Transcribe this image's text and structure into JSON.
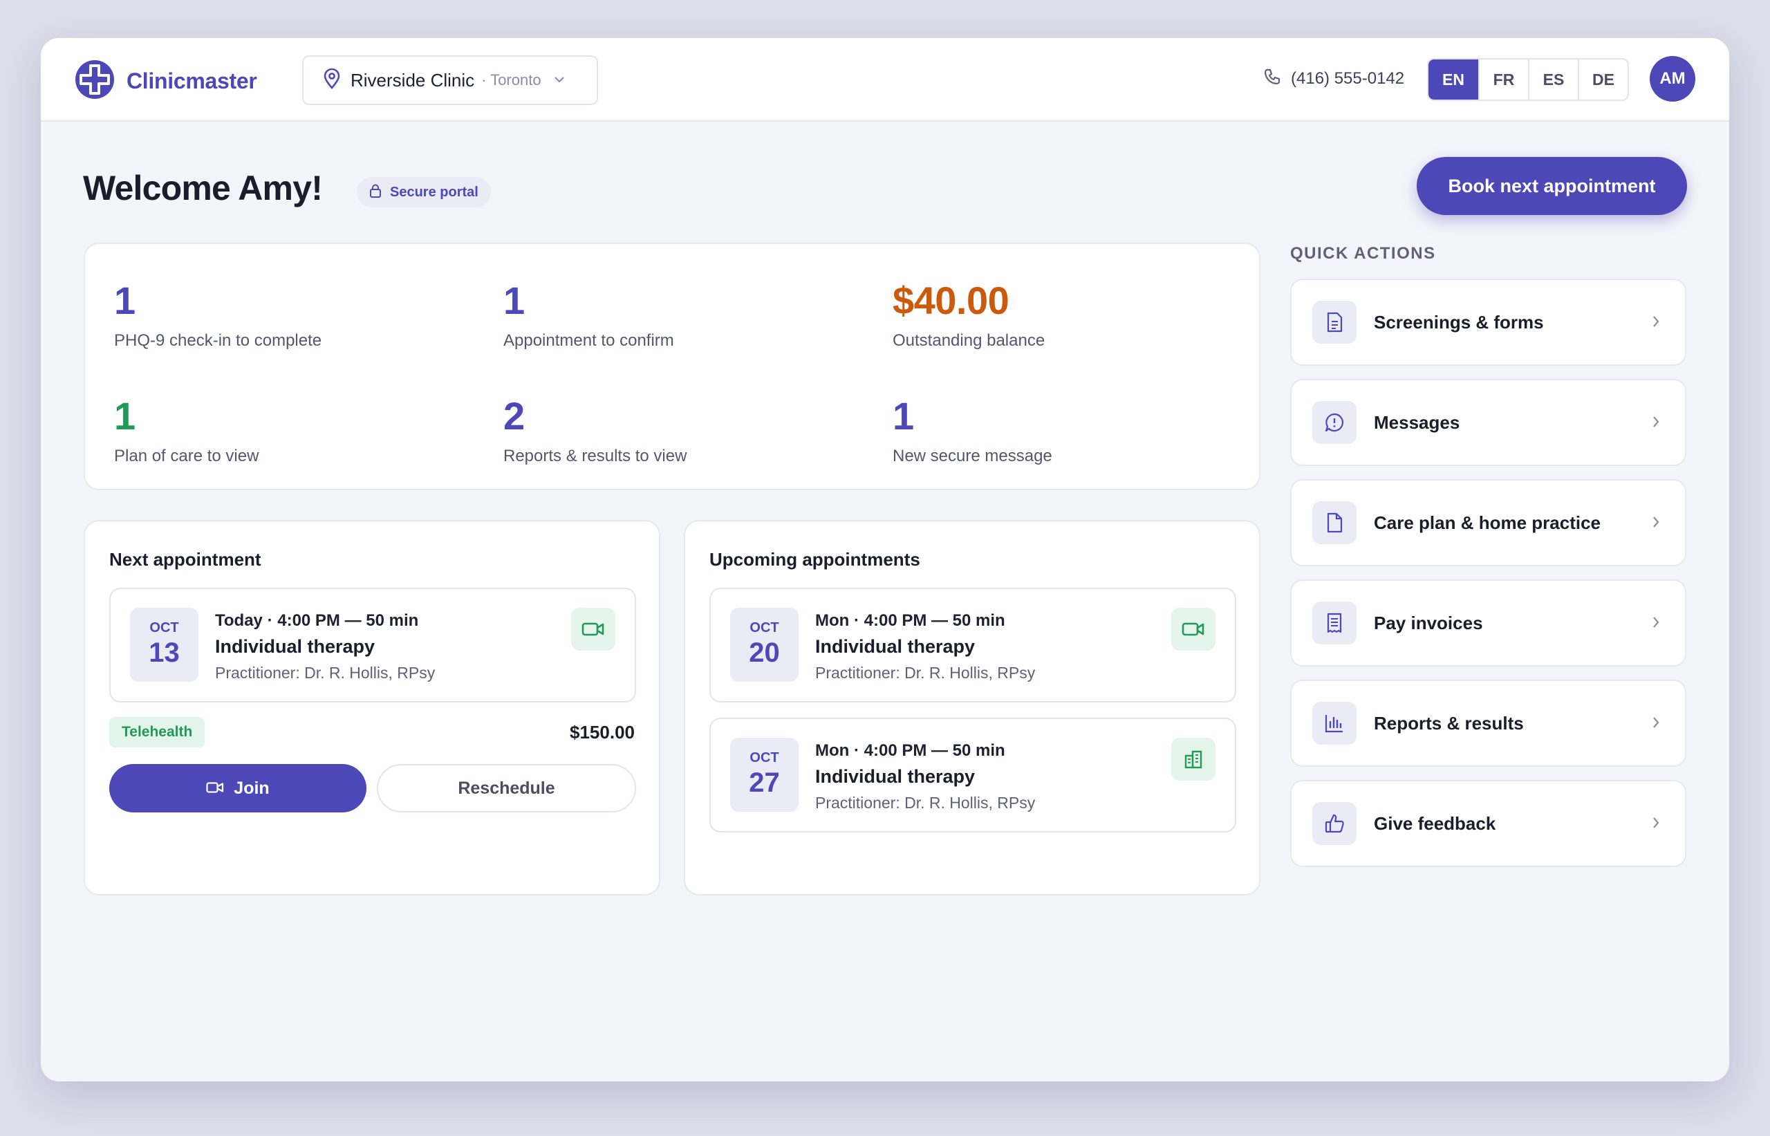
{
  "header": {
    "brand_name": "Clinicmaster",
    "clinic_name": "Riverside Clinic",
    "clinic_city": "· Toronto",
    "phone": "(416) 555-0142",
    "languages": [
      "EN",
      "FR",
      "ES",
      "DE"
    ],
    "active_language": "EN",
    "avatar_initials": "AM"
  },
  "page": {
    "welcome": "Welcome Amy!",
    "secure_badge": "Secure portal",
    "book_button": "Book next appointment"
  },
  "summary": [
    {
      "value": "1",
      "label": "PHQ-9 check-in to complete",
      "color": "#4d48b8"
    },
    {
      "value": "1",
      "label": "Appointment to confirm",
      "color": "#4d48b8"
    },
    {
      "value": "$40.00",
      "label": "Outstanding balance",
      "color": "#cc5a0c"
    },
    {
      "value": "1",
      "label": "Plan of care to view",
      "color": "#1f9a57"
    },
    {
      "value": "2",
      "label": "Reports & results to view",
      "color": "#4d48b8"
    },
    {
      "value": "1",
      "label": "New secure message",
      "color": "#4d48b8"
    }
  ],
  "next_appointment": {
    "title": "Next appointment",
    "month": "OCT",
    "day": "13",
    "time": "Today · 4:00 PM — 50 min",
    "type": "Individual therapy",
    "practitioner": "Practitioner: Dr. R. Hollis, RPsy",
    "icon": "video-icon",
    "badge": "Telehealth",
    "price": "$150.00",
    "join_label": "Join",
    "reschedule_label": "Reschedule"
  },
  "upcoming": {
    "title": "Upcoming appointments",
    "items": [
      {
        "month": "OCT",
        "day": "20",
        "time": "Mon · 4:00 PM — 50 min",
        "type": "Individual therapy",
        "practitioner": "Practitioner: Dr. R. Hollis, RPsy",
        "icon": "video-icon"
      },
      {
        "month": "OCT",
        "day": "27",
        "time": "Mon · 4:00 PM — 50 min",
        "type": "Individual therapy",
        "practitioner": "Practitioner: Dr. R. Hollis, RPsy",
        "icon": "building-icon"
      }
    ]
  },
  "quick_actions": {
    "heading": "QUICK ACTIONS",
    "items": [
      {
        "label": "Screenings & forms",
        "icon": "form-icon"
      },
      {
        "label": "Messages",
        "icon": "message-icon"
      },
      {
        "label": "Care plan & home practice",
        "icon": "document-icon"
      },
      {
        "label": "Pay invoices",
        "icon": "invoice-icon"
      },
      {
        "label": "Reports & results",
        "icon": "chart-icon"
      },
      {
        "label": "Give feedback",
        "icon": "thumbs-up-icon"
      }
    ]
  },
  "colors": {
    "accent": "#4d48b8",
    "success": "#1f9a57",
    "warning": "#cc5a0c"
  }
}
